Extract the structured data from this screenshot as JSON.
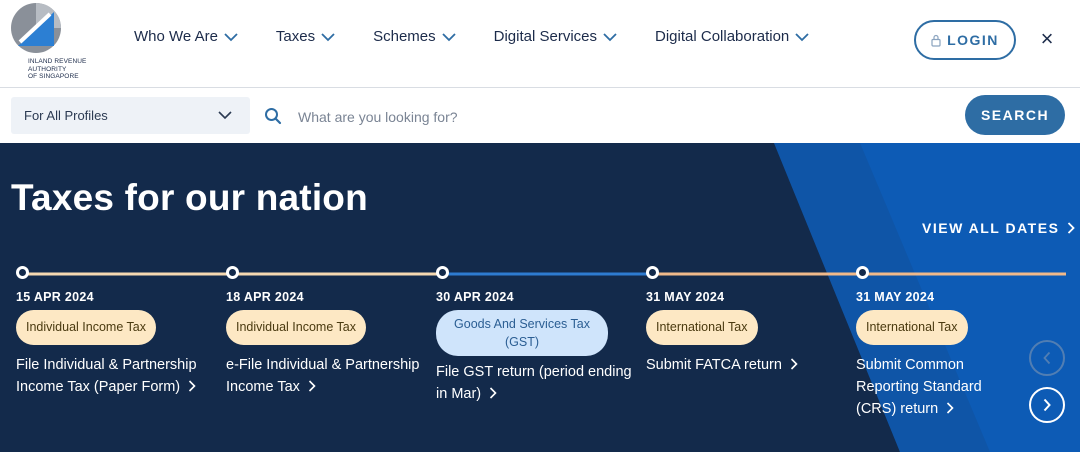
{
  "logo": {
    "text": "INLAND REVENUE\nAUTHORITY\nOF SINGAPORE"
  },
  "nav": {
    "items": [
      {
        "label": "Who We Are"
      },
      {
        "label": "Taxes"
      },
      {
        "label": "Schemes"
      },
      {
        "label": "Digital Services"
      },
      {
        "label": "Digital Collaboration"
      }
    ],
    "login_label": "LOGIN",
    "close_symbol": "×"
  },
  "search": {
    "profile_selected": "For All Profiles",
    "placeholder": "What are you looking for?",
    "button_label": "SEARCH"
  },
  "hero": {
    "title": "Taxes for our nation",
    "view_all_label": "VIEW ALL DATES",
    "events": [
      {
        "date": "15 APR 2024",
        "tag": "Individual Income Tax",
        "description": "File Individual & Partnership Income Tax (Paper Form)"
      },
      {
        "date": "18 APR 2024",
        "tag": "Individual Income Tax",
        "description": "e-File Individual & Partnership Income Tax"
      },
      {
        "date": "30 APR 2024",
        "tag": "Goods And Services Tax (GST)",
        "description": "File GST return (period ending in Mar)"
      },
      {
        "date": "31 MAY 2024",
        "tag": "International Tax",
        "description": "Submit FATCA return"
      },
      {
        "date": "31 MAY 2024",
        "tag": "International Tax",
        "description": "Submit Common Reporting Standard (CRS) return"
      }
    ]
  },
  "colors": {
    "navy": "#132a4b",
    "brand_blue": "#2e6da4",
    "accent_blue": "#0d5bb5",
    "tag_orange": "#fde8c4",
    "tag_blue": "#cfe4fb"
  }
}
